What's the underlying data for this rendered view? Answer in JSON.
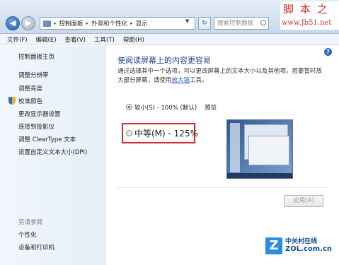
{
  "address_bar": {
    "crumbs": [
      "控制面板",
      "外观和个性化",
      "显示"
    ],
    "search_placeholder": "搜索控制面板"
  },
  "watermarks": {
    "site_name": "脚 本 之 家",
    "site_url": "www.Jb51.net",
    "zol_logo_letter": "Z",
    "zol_cn": "中关村在线",
    "zol_url": "ZOL.com.cn"
  },
  "menu": [
    "文件(F)",
    "编辑(E)",
    "查看(V)",
    "工具(T)",
    "帮助(H)"
  ],
  "sidebar": {
    "home": "控制面板主页",
    "items": [
      "调整分辨率",
      "调整亮度",
      "校准颜色",
      "更改显示器设置",
      "连接到投影仪",
      "调整 ClearType 文本",
      "设置自定义文本大小(DPI)"
    ],
    "see_also": "另请参阅",
    "see_also_items": [
      "个性化",
      "设备和打印机"
    ]
  },
  "main": {
    "title": "使阅读屏幕上的内容更容易",
    "desc_line1": "通过选择其中一个选项，可以更改屏幕上的文本大小以及其他项。若要暂时放",
    "desc_line2_pre": "大部分屏幕，请使用",
    "desc_link": "放大镜",
    "desc_line2_post": "工具。",
    "option_small": "较小(S) - 100% (默认)",
    "preview_label": "预览",
    "option_medium": "中等(M) - 125%",
    "apply": "应用(A)",
    "help_symbol": "?"
  },
  "colors": {
    "title": "#1c3f94",
    "highlight_box": "#d9282b",
    "link": "#1a5fc7"
  }
}
